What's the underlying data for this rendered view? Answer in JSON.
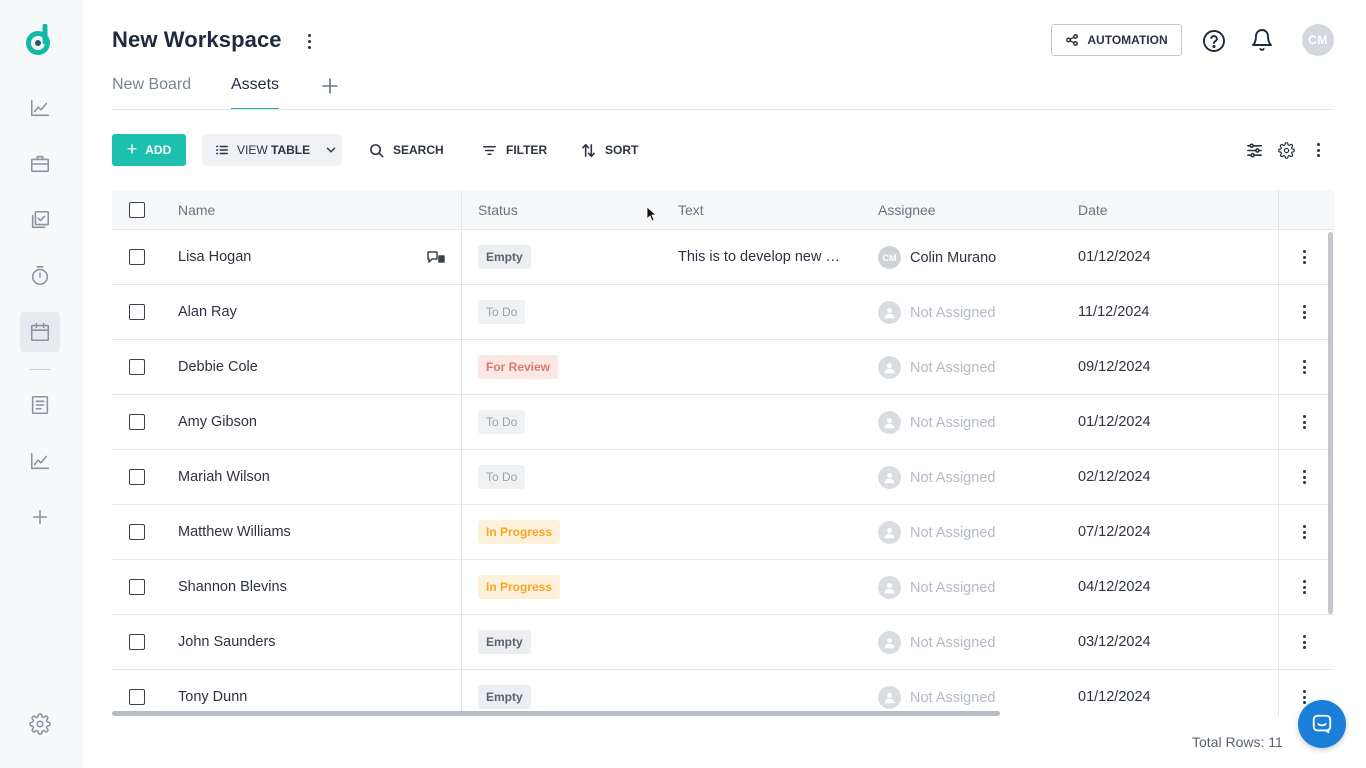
{
  "workspace": {
    "title": "New Workspace"
  },
  "header": {
    "automation_label": "AUTOMATION",
    "avatar_initials": "CM"
  },
  "tabs": [
    {
      "label": "New Board",
      "active": false
    },
    {
      "label": "Assets",
      "active": true
    }
  ],
  "toolbar": {
    "add_label": "ADD",
    "view_prefix": "VIEW",
    "view_value": "TABLE",
    "search_label": "SEARCH",
    "filter_label": "FILTER",
    "sort_label": "SORT"
  },
  "table": {
    "columns": [
      "Name",
      "Status",
      "Text",
      "Assignee",
      "Date"
    ],
    "rows": [
      {
        "name": "Lisa Hogan",
        "status": "Empty",
        "status_type": "empty",
        "text": "This is to develop new …",
        "assignee": "Colin Murano",
        "assignee_initials": "CM",
        "assigned": true,
        "date": "01/12/2024"
      },
      {
        "name": "Alan Ray",
        "status": "To Do",
        "status_type": "todo",
        "text": "",
        "assignee": "Not Assigned",
        "assigned": false,
        "date": "11/12/2024"
      },
      {
        "name": "Debbie Cole",
        "status": "For Review",
        "status_type": "review",
        "text": "",
        "assignee": "Not Assigned",
        "assigned": false,
        "date": "09/12/2024"
      },
      {
        "name": "Amy Gibson",
        "status": "To Do",
        "status_type": "todo",
        "text": "",
        "assignee": "Not Assigned",
        "assigned": false,
        "date": "01/12/2024"
      },
      {
        "name": "Mariah Wilson",
        "status": "To Do",
        "status_type": "todo",
        "text": "",
        "assignee": "Not Assigned",
        "assigned": false,
        "date": "02/12/2024"
      },
      {
        "name": "Matthew Williams",
        "status": "In Progress",
        "status_type": "progress",
        "text": "",
        "assignee": "Not Assigned",
        "assigned": false,
        "date": "07/12/2024"
      },
      {
        "name": "Shannon Blevins",
        "status": "In Progress",
        "status_type": "progress",
        "text": "",
        "assignee": "Not Assigned",
        "assigned": false,
        "date": "04/12/2024"
      },
      {
        "name": "John Saunders",
        "status": "Empty",
        "status_type": "empty",
        "text": "",
        "assignee": "Not Assigned",
        "assigned": false,
        "date": "03/12/2024"
      },
      {
        "name": "Tony Dunn",
        "status": "Empty",
        "status_type": "empty",
        "text": "",
        "assignee": "Not Assigned",
        "assigned": false,
        "date": "01/12/2024"
      }
    ]
  },
  "footer": {
    "total_rows": "Total Rows: 11"
  },
  "colors": {
    "accent": "#1dbfae",
    "brand": "#14b8a6",
    "chat": "#1a7fd6"
  },
  "icons": [
    "logo-icon",
    "analytics-icon",
    "briefcase-icon",
    "tasks-icon",
    "timer-icon",
    "calendar-icon",
    "document-icon",
    "chart-icon",
    "plus-icon",
    "settings-icon",
    "help-icon",
    "bell-icon",
    "automation-icon",
    "search-icon",
    "filter-icon",
    "sort-icon",
    "sliders-icon",
    "gear-icon",
    "more-vertical-icon",
    "comment-icon",
    "chat-icon"
  ]
}
